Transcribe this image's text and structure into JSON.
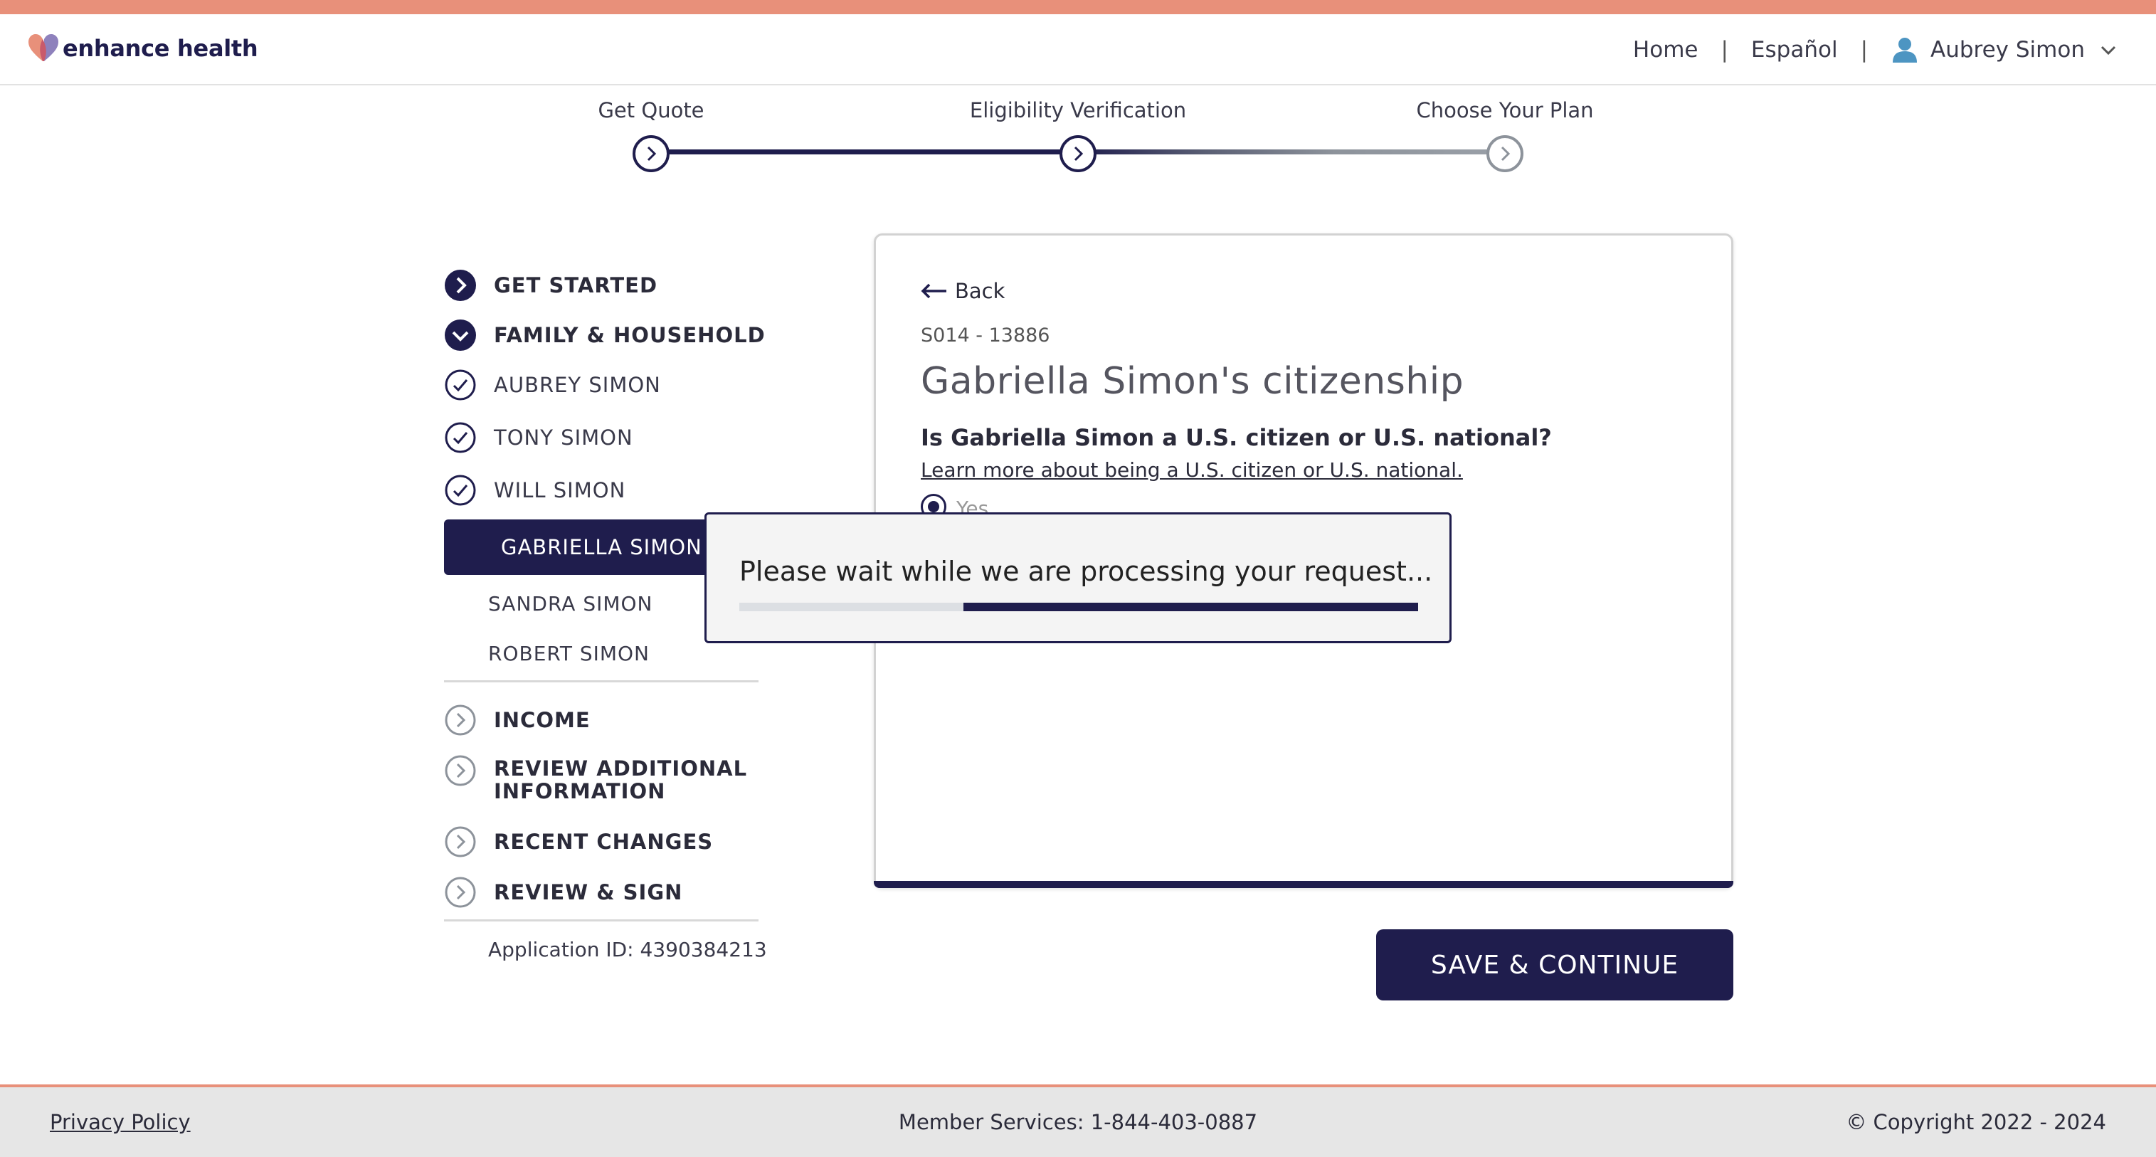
{
  "brand": {
    "name": "enhance health",
    "primary_color": "#1f1d4d",
    "accent_color": "#e8907a"
  },
  "header": {
    "home_label": "Home",
    "separator": "|",
    "language_label": "Español",
    "user_name": "Aubrey Simon"
  },
  "stepper": {
    "steps": [
      {
        "label": "Get Quote",
        "status": "complete"
      },
      {
        "label": "Eligibility Verification",
        "status": "current"
      },
      {
        "label": "Choose Your Plan",
        "status": "upcoming"
      }
    ]
  },
  "sidebar": {
    "sections": [
      {
        "label": "GET STARTED",
        "icon": "chevron-right-circle-filled-icon"
      },
      {
        "label": "FAMILY & HOUSEHOLD",
        "icon": "chevron-down-circle-filled-icon"
      },
      {
        "label": "INCOME",
        "icon": "chevron-right-circle-outline-icon"
      },
      {
        "label": "REVIEW ADDITIONAL INFORMATION",
        "icon": "chevron-right-circle-outline-icon"
      },
      {
        "label": "RECENT CHANGES",
        "icon": "chevron-right-circle-outline-icon"
      },
      {
        "label": "REVIEW & SIGN",
        "icon": "chevron-right-circle-outline-icon"
      }
    ],
    "completed_members": [
      {
        "label": "AUBREY SIMON",
        "icon": "check-circle-icon"
      },
      {
        "label": "TONY SIMON",
        "icon": "check-circle-icon"
      },
      {
        "label": "WILL SIMON",
        "icon": "check-circle-icon"
      }
    ],
    "active_member": "GABRIELLA SIMON",
    "pending_members": [
      "SANDRA SIMON",
      "ROBERT SIMON"
    ],
    "application_id": "Application ID: 4390384213"
  },
  "card": {
    "back_label": "Back",
    "code": "S014 - 13886",
    "title": "Gabriella Simon's citizenship",
    "question": "Is Gabriella Simon a U.S. citizen or U.S. national?",
    "learn_more": "Learn more about being a U.S. citizen or U.S. national.",
    "option_yes": "Yes"
  },
  "modal": {
    "message": "Please wait while we are processing your request...",
    "progress_start": 0.33,
    "progress_end": 1.0
  },
  "actions": {
    "save_continue": "SAVE & CONTINUE"
  },
  "footer": {
    "privacy": "Privacy Policy",
    "member_services": "Member Services: 1-844-403-0887",
    "copyright": "© Copyright 2022 - 2024"
  }
}
